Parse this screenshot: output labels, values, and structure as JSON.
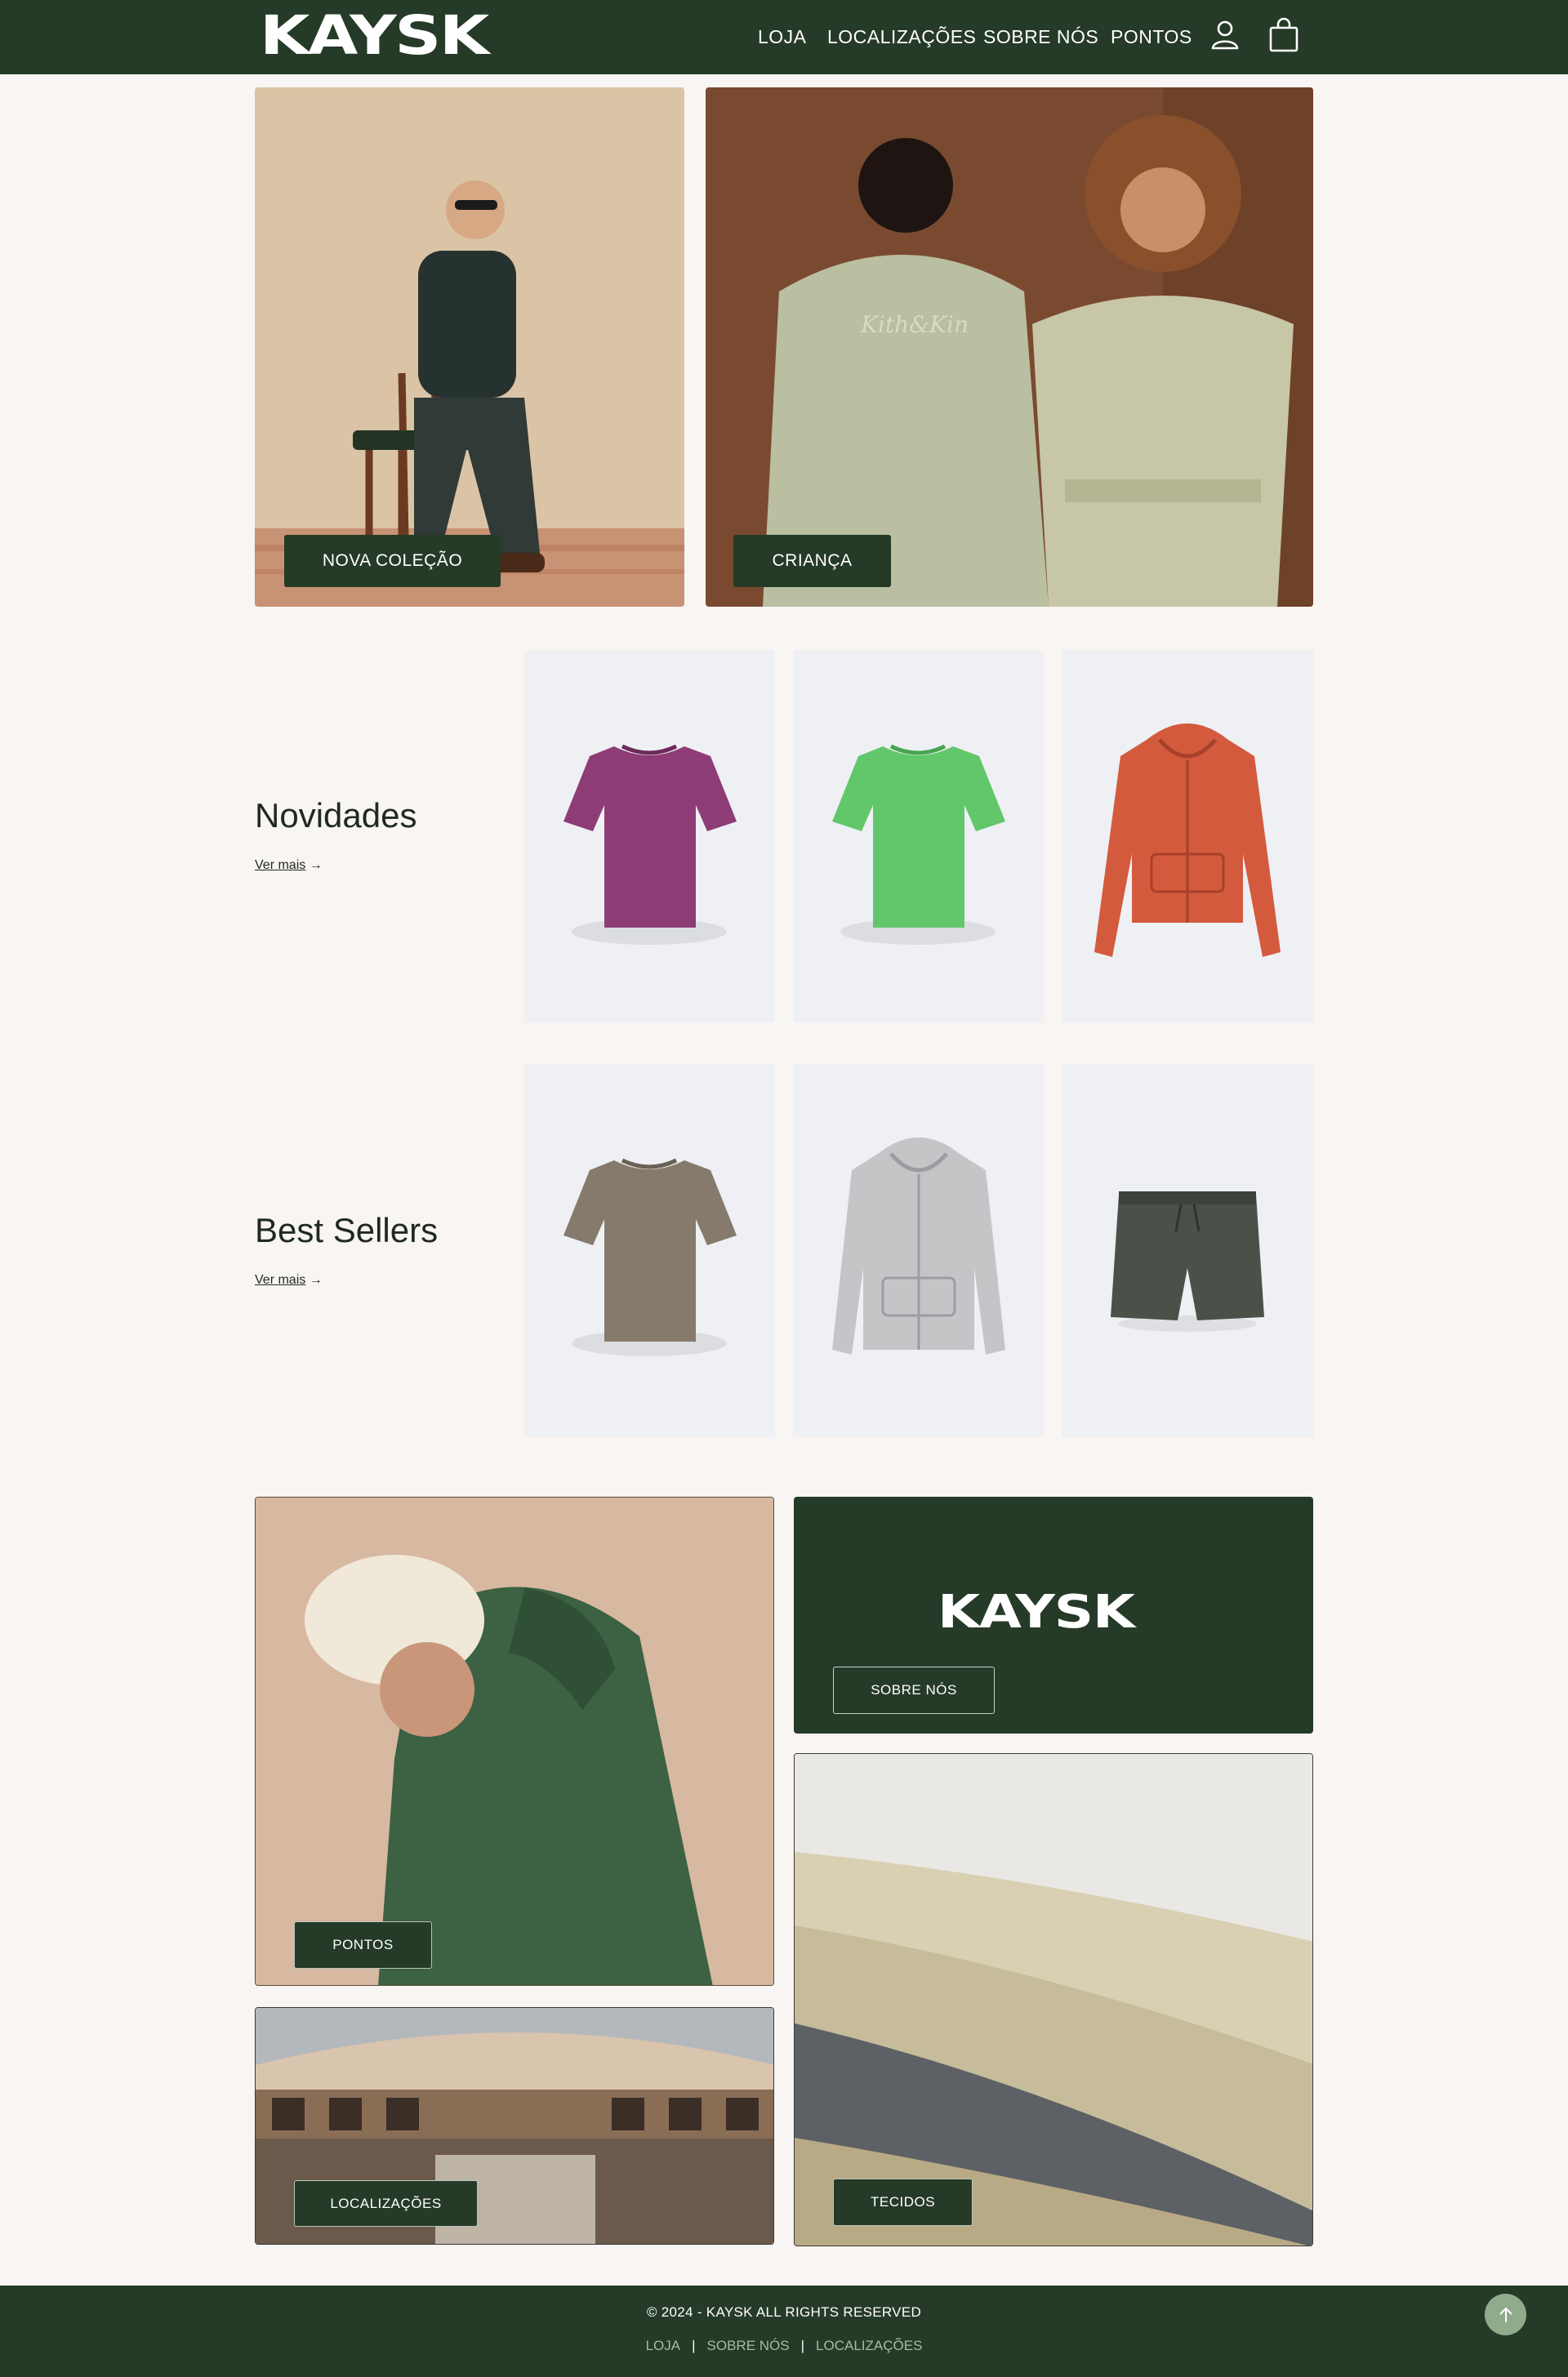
{
  "header": {
    "logo": "KAYSK",
    "nav": [
      "LOJA",
      "LOCALIZAÇÕES",
      "SOBRE NÓS",
      "PONTOS"
    ],
    "icons": [
      "user-icon",
      "shopping-bag-icon"
    ]
  },
  "hero": {
    "left_button": "NOVA COLEÇÃO",
    "right_button": "CRIANÇA"
  },
  "novidades": {
    "title": "Novidades",
    "link": "Ver mais",
    "products": [
      "magenta t-shirt",
      "green t-shirt",
      "orange zip hoodie"
    ]
  },
  "best_sellers": {
    "title": "Best Sellers",
    "link": "Ver mais",
    "products": [
      "taupe t-shirt",
      "grey zip hoodie",
      "dark green shorts"
    ]
  },
  "promo": {
    "pontos": "PONTOS",
    "brand_logo": "KAYSK",
    "sobre": "SOBRE NÓS",
    "localizacoes": "LOCALIZAÇÕES",
    "tecidos": "TECIDOS"
  },
  "footer": {
    "copyright": "© 2024 - KAYSK ALL RIGHTS RESERVED",
    "links": [
      "LOJA",
      "SOBRE NÓS",
      "LOCALIZAÇÕES"
    ]
  },
  "colors": {
    "brand_green": "#263a28",
    "background": "#f8f5f3",
    "product_bg": "#eef0f4",
    "scroll_top": "#8fab8c"
  }
}
